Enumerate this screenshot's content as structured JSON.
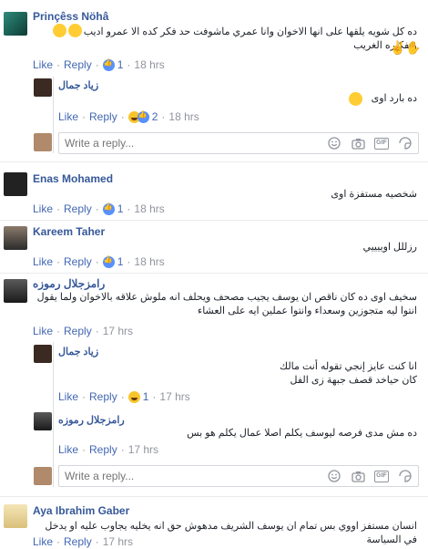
{
  "actions": {
    "like": "Like",
    "reply": "Reply"
  },
  "reply_placeholder": "Write a reply...",
  "comments": [
    {
      "name": "Prinçêss Nöhâ",
      "text": "ده كل شويه يلقها على انها الاخوان وانا عمري ماشوفت حد فكر كده الا عمرو اديب وتفكيره الغريب",
      "reaction_count": "1",
      "time": "18 hrs",
      "reaction": "like"
    },
    {
      "name": "زياد جمال",
      "text": "ده بارد اوى",
      "reaction_count": "2",
      "time": "18 hrs",
      "reaction": "haha-like"
    },
    {
      "name": "Enas Mohamed",
      "text": "شخصيه مستفزة اوى",
      "reaction_count": "1",
      "time": "18 hrs",
      "reaction": "like"
    },
    {
      "name": "Kareem Taher",
      "text": "رزللل اوييييي",
      "reaction_count": "1",
      "time": "18 hrs",
      "reaction": "like"
    },
    {
      "name": "رامزجلال رموزه",
      "text": "سخيف اوى ده كان ناقص ان يوسف يجيب مصحف ويحلف انه ملوش علاقه بالاخوان ولما يقول انتوا ليه متجوزين وسعداء وانتوا عملين ايه على العشاء",
      "time": "17 hrs"
    },
    {
      "name": "زياد جمال",
      "text_line1": "انا كنت عايز إنجي تقوله أنت مالك",
      "text_line2": "كان حياخد قصف جبهة زى الفل",
      "reaction_count": "1",
      "time": "17 hrs",
      "reaction": "haha"
    },
    {
      "name": "رامزجلال رموزه",
      "text": "ده مش مدى فرصه ليوسف يكلم اصلا عمال يكلم هو بس",
      "time": "17 hrs"
    },
    {
      "name": "Aya Ibrahim Gaber",
      "text": "انسان مستفز اووي بس تمام ان يوسف الشريف مدهوش حق انه يخليه يجاوب عليه او يدخل في السياسة",
      "time": "17 hrs"
    }
  ],
  "colors": {
    "link": "#4267b2",
    "name": "#365899",
    "muted": "#90949c",
    "like": "#5890ff",
    "haha": "#f7c42c"
  }
}
